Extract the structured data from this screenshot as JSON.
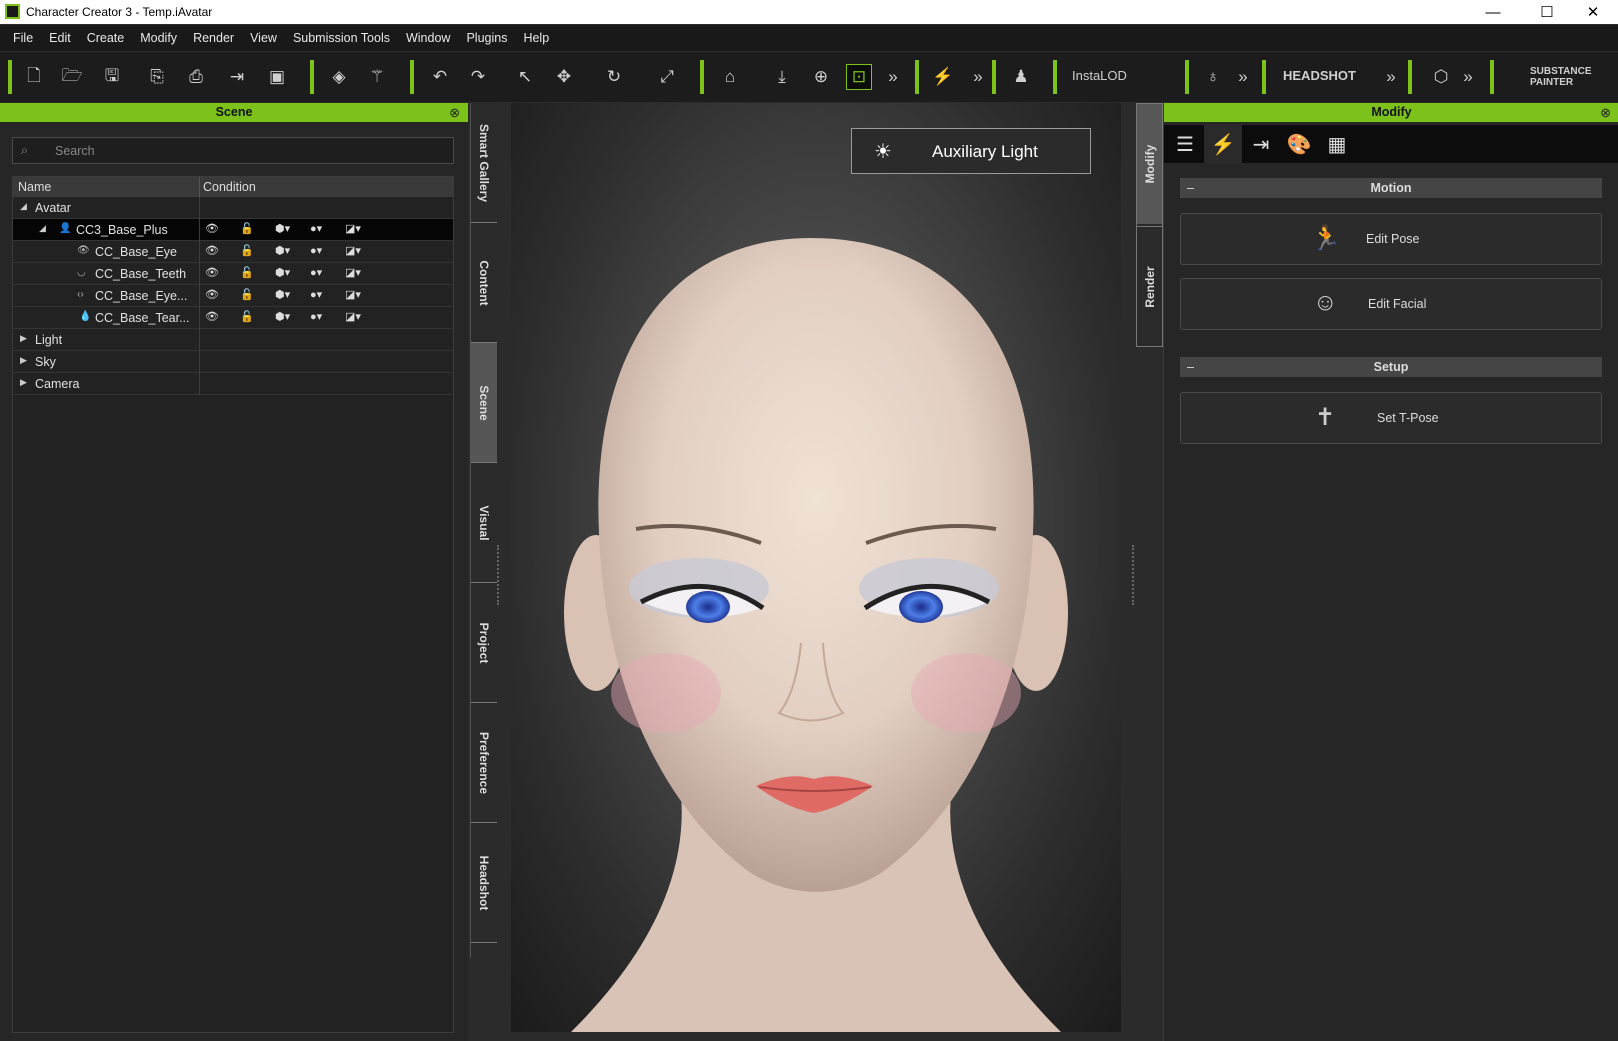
{
  "titlebar": {
    "title": "Character Creator 3 - Temp.iAvatar",
    "minimize": "—",
    "maximize": "☐",
    "close": "✕"
  },
  "menu": [
    "File",
    "Edit",
    "Create",
    "Modify",
    "Render",
    "View",
    "Submission Tools",
    "Window",
    "Plugins",
    "Help"
  ],
  "toolbar": {
    "instalod": "InstaLOD",
    "headshot": "HEADSHOT",
    "substance": "SUBSTANCE PAINTER"
  },
  "scene_panel": {
    "title": "Scene",
    "search_placeholder": "Search",
    "columns": {
      "name": "Name",
      "condition": "Condition"
    },
    "rows": [
      {
        "label": "Avatar",
        "expanded": true
      },
      {
        "label": "CC3_Base_Plus",
        "expanded": true,
        "selected": true
      },
      {
        "label": "CC_Base_Eye"
      },
      {
        "label": "CC_Base_Teeth"
      },
      {
        "label": "CC_Base_Eye..."
      },
      {
        "label": "CC_Base_Tear..."
      },
      {
        "label": "Light",
        "expanded": false
      },
      {
        "label": "Sky",
        "expanded": false
      },
      {
        "label": "Camera",
        "expanded": false
      }
    ]
  },
  "left_tabs": [
    "Smart Gallery",
    "Content",
    "Scene",
    "Visual",
    "Project",
    "Preference",
    "Headshot"
  ],
  "left_tabs_active": "Scene",
  "viewport": {
    "aux_light_label": "Auxiliary Light"
  },
  "right_tabs": [
    "Modify",
    "Render"
  ],
  "right_tabs_active": "Modify",
  "modify_panel": {
    "title": "Modify",
    "tab_icons": [
      "sliders-icon",
      "motion-icon",
      "morph-icon",
      "palette-icon",
      "checker-icon"
    ],
    "active_tab": "motion-icon",
    "sections": {
      "motion": {
        "label": "Motion",
        "buttons": {
          "edit_pose": "Edit Pose",
          "edit_facial": "Edit Facial"
        }
      },
      "setup": {
        "label": "Setup",
        "buttons": {
          "set_tpose": "Set T-Pose"
        }
      }
    }
  },
  "colors": {
    "accent": "#7cc21a",
    "panel_bg": "#262626",
    "toolbar_bg": "#1c1c1c"
  }
}
